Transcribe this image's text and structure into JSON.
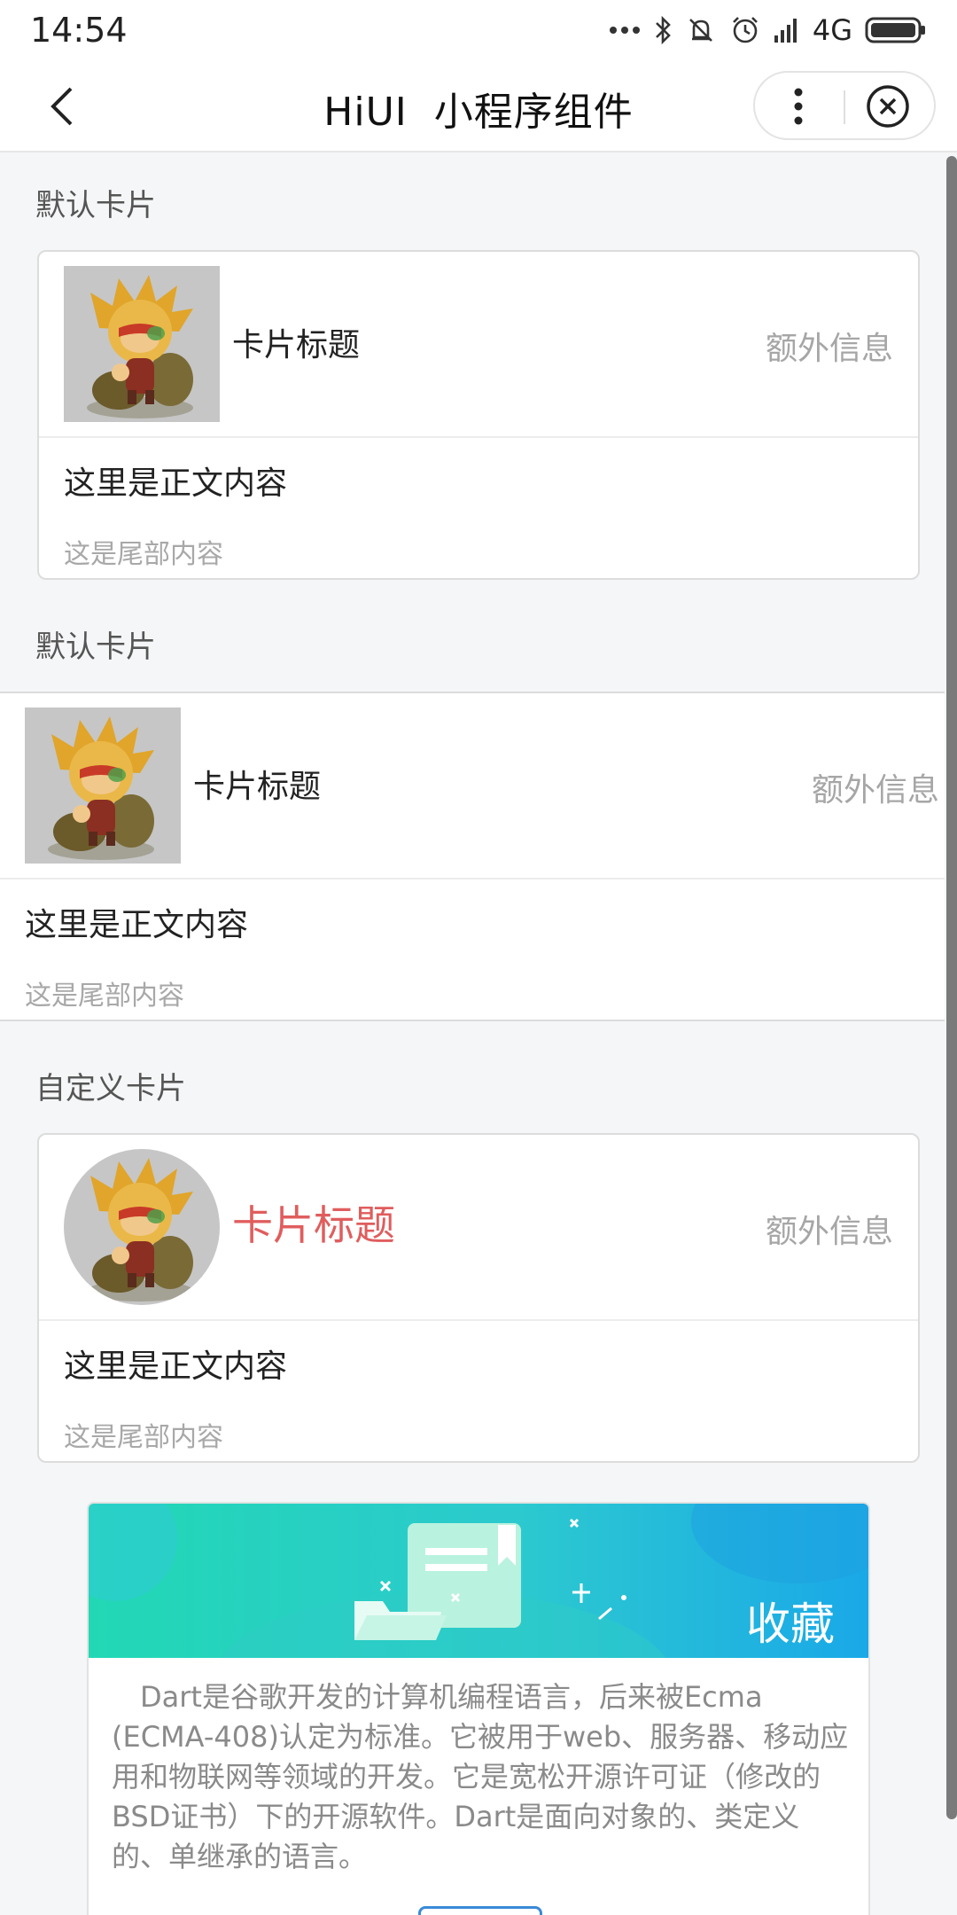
{
  "status_bar": {
    "time": "14:54",
    "network": "4G"
  },
  "nav": {
    "title": "HiUI  小程序组件"
  },
  "sections": [
    {
      "title": "默认卡片",
      "card": {
        "title": "卡片标题",
        "extra": "额外信息",
        "body": "这里是正文内容",
        "footer": "这是尾部内容"
      }
    },
    {
      "title": "默认卡片",
      "card": {
        "title": "卡片标题",
        "extra": "额外信息",
        "body": "这里是正文内容",
        "footer": "这是尾部内容"
      }
    },
    {
      "title": "自定义卡片",
      "card": {
        "title": "卡片标题",
        "extra": "额外信息",
        "body": "这里是正文内容",
        "footer": "这是尾部内容"
      }
    }
  ],
  "banner_card": {
    "banner_label": "收藏",
    "description": "　Dart是谷歌开发的计算机编程语言，后来被Ecma (ECMA-408)认定为标准。它被用于web、服务器、移动应用和物联网等领域的开发。它是宽松开源许可证（修改的BSD证书）下的开源软件。Dart是面向对象的、类定义的、单继承的语言。"
  },
  "colors": {
    "title_accent": "#e05d5d",
    "banner_start": "#22d8b4",
    "banner_end": "#1aa8e8"
  }
}
